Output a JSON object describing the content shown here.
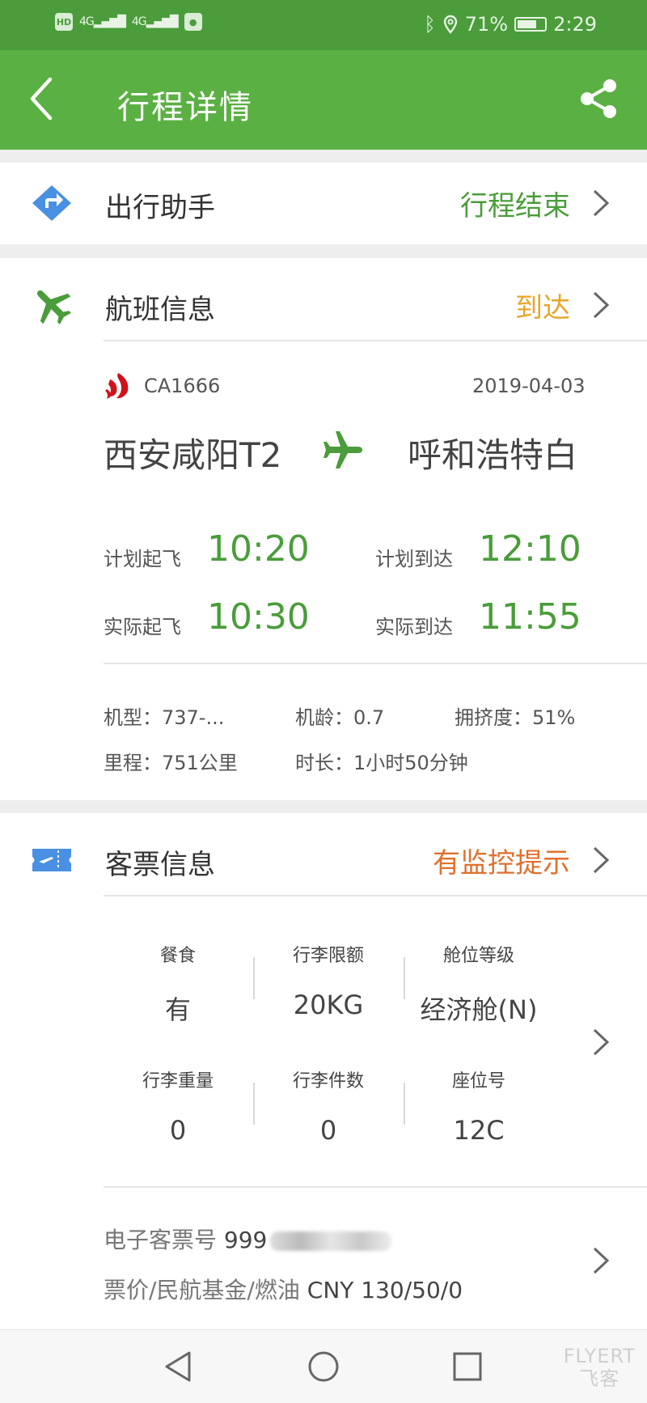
{
  "status_bar": {
    "hd": "HD",
    "net1": "4G",
    "net2": "4G",
    "battery": "71%",
    "battery_level": 0.71,
    "time": "2:29"
  },
  "header": {
    "title": "行程详情"
  },
  "assistant": {
    "label": "出行助手",
    "status": "行程结束"
  },
  "flight": {
    "label": "航班信息",
    "status": "到达",
    "flight_no": "CA1666",
    "date": "2019-04-03",
    "from": "西安咸阳T2",
    "to": "呼和浩特白",
    "plan_dep_label": "计划起飞",
    "plan_dep": "10:20",
    "plan_arr_label": "计划到达",
    "plan_arr": "12:10",
    "act_dep_label": "实际起飞",
    "act_dep": "10:30",
    "act_arr_label": "实际到达",
    "act_arr": "11:55",
    "aircraft_label": "机型：",
    "aircraft": "737-...",
    "age_label": "机龄：",
    "age": "0.7",
    "crowd_label": "拥挤度：",
    "crowd": "51%",
    "distance_label": "里程：",
    "distance": "751公里",
    "duration_label": "时长：",
    "duration": "1小时50分钟"
  },
  "ticket": {
    "label": "客票信息",
    "status": "有监控提示",
    "meal_label": "餐食",
    "meal": "有",
    "baggage_limit_label": "行李限额",
    "baggage_limit": "20KG",
    "cabin_label": "舱位等级",
    "cabin": "经济舱(N)",
    "baggage_weight_label": "行李重量",
    "baggage_weight": "0",
    "baggage_count_label": "行李件数",
    "baggage_count": "0",
    "seat_label": "座位号",
    "seat": "12C",
    "eticket_label": "电子客票号",
    "eticket_prefix": "999",
    "fare_label": "票价/民航基金/燃油",
    "fare": "CNY 130/50/0"
  },
  "watermark": {
    "line1": "FLYERT",
    "line2": "飞客"
  },
  "colors": {
    "status_bar": "#4a9d3a",
    "app_bar": "#5bb043",
    "green_text": "#4a9d3a",
    "arrived": "#e8a52a",
    "warning": "#e0702e",
    "icon_blue": "#4a90e2"
  }
}
